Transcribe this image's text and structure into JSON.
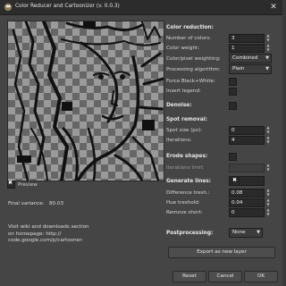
{
  "window": {
    "title": "Color Reducer and Cartoonizer (v. 0.0.3)",
    "close_label": "✕"
  },
  "preview": {
    "label": "Preview",
    "checked": true
  },
  "variance": {
    "label": "Final variance:",
    "value": "80.03"
  },
  "info": {
    "line1": "Visit wiki and downloads section",
    "line2": "on homepage: http://",
    "line3": "code.google.com/p/cartooner-"
  },
  "color_reduction": {
    "heading": "Color reduction:",
    "number_of_colors": {
      "label": "Number of colors:",
      "value": "3"
    },
    "color_weight": {
      "label": "Color weight:",
      "value": "1"
    },
    "pixel_weighting": {
      "label": "Color/pixel weighting:",
      "value": "Combined"
    },
    "processing_algorithm": {
      "label": "Processing algorithm:",
      "value": "Plain"
    },
    "force_bw": {
      "label": "Force Black+White:",
      "checked": false
    },
    "insert_legend": {
      "label": "Insert legend:",
      "checked": false
    }
  },
  "denoise": {
    "label": "Denoise:",
    "checked": false
  },
  "spot_removal": {
    "heading": "Spot removal:",
    "spot_size": {
      "label": "Spot size (px):",
      "value": "0"
    },
    "iterations": {
      "label": "Iterations:",
      "value": "4"
    }
  },
  "erode": {
    "label": "Erode shapes:",
    "checked": false,
    "iterations_label": "Iterations limit:"
  },
  "generate_lines": {
    "label": "Generate lines:",
    "checked": true,
    "difference_treshold": {
      "label": "Difference tresh.:",
      "value": "0.08"
    },
    "hue_treshold": {
      "label": "Hue treshold:",
      "value": "0.04"
    },
    "remove_short": {
      "label": "Remove short:",
      "value": "0"
    }
  },
  "postprocessing": {
    "label": "Postprocessing:",
    "value": "None"
  },
  "buttons": {
    "export": "Export as new layer",
    "reset": "Reset",
    "cancel": "Cancel",
    "ok": "OK"
  }
}
